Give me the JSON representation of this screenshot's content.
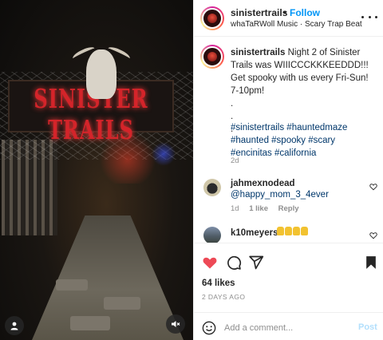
{
  "post": {
    "username": "sinistertrails",
    "follow_label": "Follow",
    "separator": "•",
    "audio": "whaTaRWoll Music · Scary Trap Beat",
    "media_sign_text": "SINISTER TRAILS"
  },
  "caption": {
    "username": "sinistertrails",
    "text": "Night 2 of Sinister Trails was WIIICCCKKKEEDDD!!! Get spooky with us every Fri-Sun! 7-10pm!\n.\n.\n.",
    "hashtags": "#sinistertrails #hauntedmaze #haunted #spooky #scary #encinitas #california",
    "age": "2d"
  },
  "comments": [
    {
      "username": "jahmexnodead",
      "text": "@happy_mom_3_4ever",
      "age": "1d",
      "likes": "1 like",
      "reply": "Reply"
    },
    {
      "username": "k10meyers",
      "emoji_count": 4
    }
  ],
  "actions": {
    "likes": "64 likes",
    "date": "2 DAYS AGO",
    "comment_placeholder": "Add a comment...",
    "post_label": "Post"
  },
  "colors": {
    "accent": "#0095f6",
    "like_red": "#ed4956",
    "link": "#00376b",
    "muted": "#8e8e8e",
    "post_disabled": "#b2dffc"
  },
  "icons": {
    "user_tag": "user-icon",
    "mute": "speaker-muted-icon",
    "more": "more-horizontal-icon",
    "like": "heart-filled-icon",
    "comment": "comment-bubble-icon",
    "share": "paper-plane-icon",
    "save": "bookmark-icon",
    "emoji": "smiley-icon"
  }
}
